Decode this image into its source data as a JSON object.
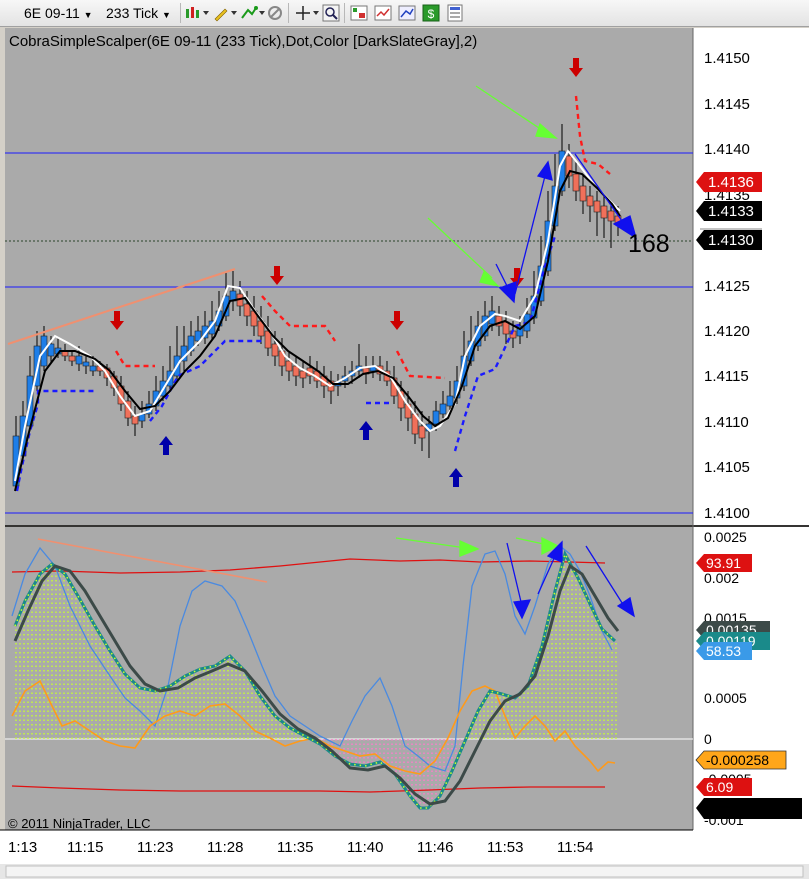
{
  "toolbar": {
    "instrument": "6E 09-11",
    "interval": "233 Tick"
  },
  "colors": {
    "panel_bg": "#aaaaaa",
    "up_candle": "#1e7ee8",
    "down_candle": "#f0705a",
    "ma_black": "#000000",
    "ma_white": "#ffffff",
    "stop_red": "#ff1a1a",
    "stop_blue": "#1a1aff",
    "level_line": "#1a1aff",
    "osc_dark": "#3c4a48",
    "osc_teal": "#1a8a8a",
    "osc_thin": "#4a8ae0",
    "osc_orange": "#ff9a1a",
    "osc_band": "#e01010",
    "fill_up": "#c8ff30",
    "fill_down": "#ff7acc",
    "arrow_green": "#66ff33",
    "arrow_blue": "#1010ee"
  },
  "price_panel": {
    "indicator_label": "CobraSimpleScalper(6E 09-11 (233 Tick),Dot,Color [DarkSlateGray],2)",
    "axis_labels": [
      "1.4150",
      "1.4145",
      "1.4140",
      "1.4135",
      "1.4125",
      "1.4120",
      "1.4115",
      "1.4110",
      "1.4105",
      "1.4100"
    ],
    "price_tags": [
      {
        "text": "1.4136",
        "style": "red"
      },
      {
        "text": "1.4133",
        "style": "black"
      },
      {
        "text": "1.4130",
        "style": "black"
      }
    ],
    "tick_counter": "168"
  },
  "osc_panel": {
    "axis_labels": [
      "0.0025",
      "0.002",
      "0.0015",
      "0.0005",
      "0",
      "-0.0005",
      "-0.001"
    ],
    "tags": [
      {
        "text": "93.91",
        "style": "red"
      },
      {
        "text": "0.00135",
        "style": "dark"
      },
      {
        "text": "0.00119",
        "style": "teal"
      },
      {
        "text": "58.53",
        "style": "blue"
      },
      {
        "text": "-0.000258",
        "style": "orange"
      },
      {
        "text": "6.09",
        "style": "red"
      }
    ],
    "copyright": "© 2011 NinjaTrader, LLC"
  },
  "time_axis": [
    "1:13",
    "11:15",
    "11:23",
    "11:28",
    "11:35",
    "11:40",
    "11:46",
    "11:53",
    "11:54"
  ]
}
